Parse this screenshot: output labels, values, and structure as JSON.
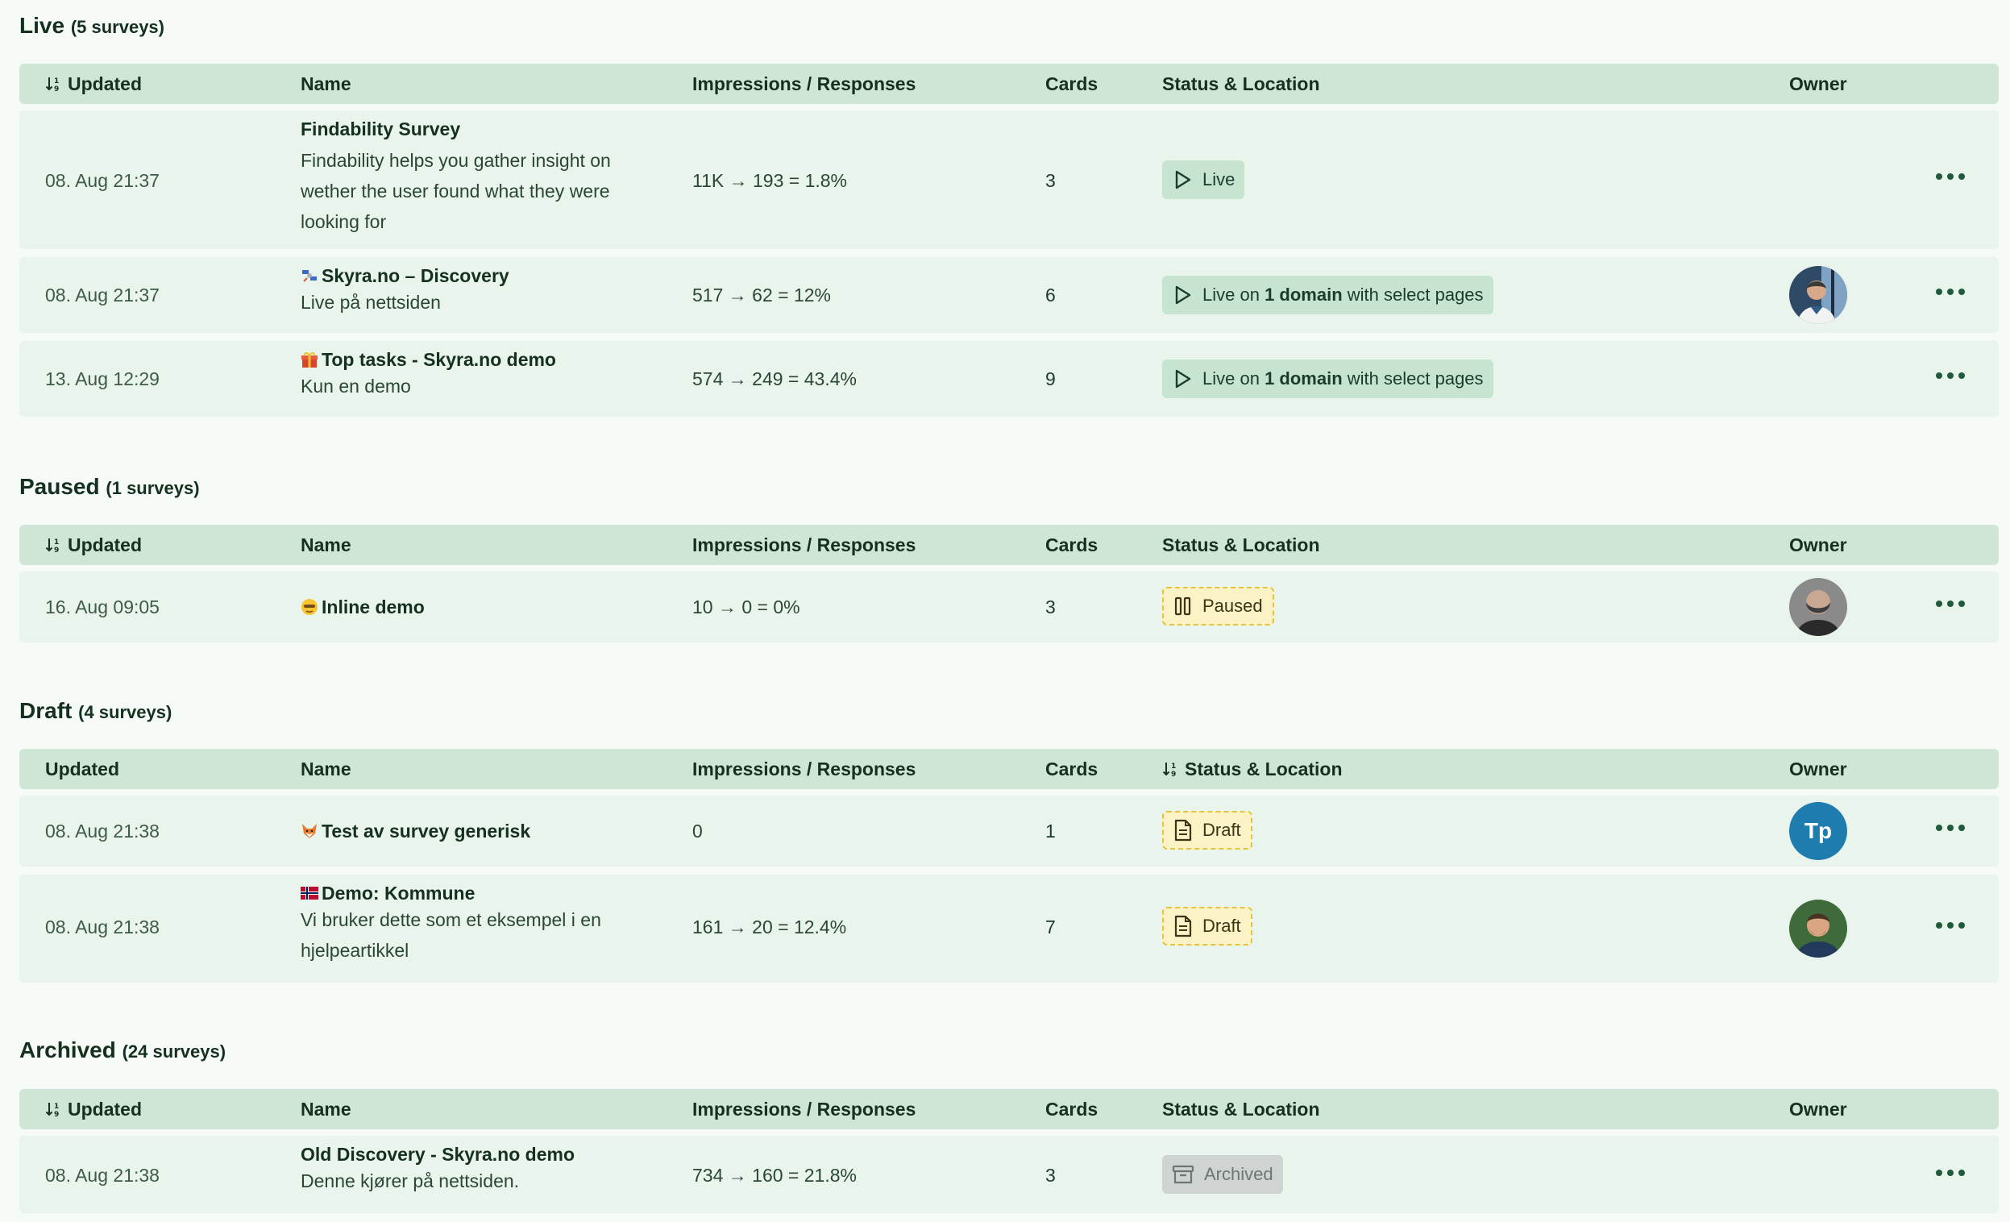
{
  "columns": {
    "updated": "Updated",
    "name": "Name",
    "impressions": "Impressions / Responses",
    "cards": "Cards",
    "status": "Status & Location",
    "owner": "Owner"
  },
  "sections": {
    "live": {
      "title": "Live",
      "count": "(5 surveys)",
      "rows": [
        {
          "updated": "08. Aug 21:37",
          "name": "Findability Survey",
          "desc": "Findability helps you gather insight on wether the user found what they were looking for",
          "impressions": "11K → 193 = 1.8%",
          "cards": "3",
          "status": "Live"
        },
        {
          "updated": "08. Aug 21:37",
          "name": "Skyra.no – Discovery",
          "desc": "Live på nettsiden",
          "impressions": "517 → 62 = 12%",
          "cards": "6",
          "status_prefix": "Live on",
          "status_bold": "1 domain",
          "status_suffix": "with select pages"
        },
        {
          "updated": "13. Aug 12:29",
          "name": "Top tasks - Skyra.no demo",
          "desc": "Kun en demo",
          "impressions": "574 → 249 = 43.4%",
          "cards": "9",
          "status_prefix": "Live on",
          "status_bold": "1 domain",
          "status_suffix": "with select pages"
        }
      ]
    },
    "paused": {
      "title": "Paused",
      "count": "(1 surveys)",
      "rows": [
        {
          "updated": "16. Aug 09:05",
          "name": "Inline demo",
          "impressions": "10 → 0 = 0%",
          "cards": "3",
          "status": "Paused"
        }
      ]
    },
    "draft": {
      "title": "Draft",
      "count": "(4 surveys)",
      "rows": [
        {
          "updated": "08. Aug 21:38",
          "name": "Test av survey generisk",
          "impressions": "0",
          "cards": "1",
          "status": "Draft",
          "owner_initials": "Tp"
        },
        {
          "updated": "08. Aug 21:38",
          "name": "Demo: Kommune",
          "desc": "Vi bruker dette som et eksempel i en hjelpeartikkel",
          "impressions": "161 → 20 = 12.4%",
          "cards": "7",
          "status": "Draft"
        }
      ]
    },
    "archived": {
      "title": "Archived",
      "count": "(24 surveys)",
      "rows": [
        {
          "updated": "08. Aug 21:38",
          "name": "Old Discovery - Skyra.no demo",
          "desc": "Denne kjører på nettsiden.",
          "impressions": "734 → 160 = 21.8%",
          "cards": "3",
          "status": "Archived"
        }
      ]
    }
  },
  "colors": {
    "header_bg": "#cfe6d7",
    "row_bg": "#e9f4ed",
    "live_badge": "#c7e4d1",
    "paused_badge": "#fbf2c5",
    "archived_badge": "#cfd3d1",
    "owner_initials_bg": "#1f7cae"
  },
  "icons": {
    "sort": "sort-descending-icon",
    "live": "play-icon",
    "paused": "pause-icon",
    "draft": "document-icon",
    "archived": "archive-box-icon",
    "menu": "more-dots-icon"
  }
}
